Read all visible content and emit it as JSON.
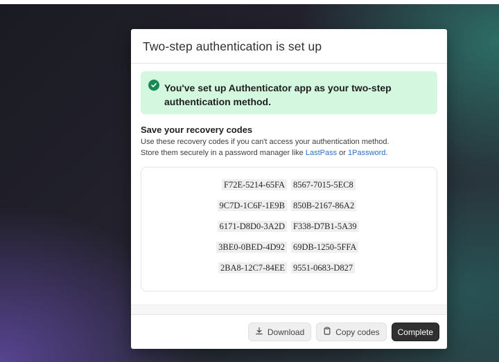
{
  "dialog": {
    "title": "Two-step authentication is set up",
    "banner": {
      "icon": "check-circle-icon",
      "text": "You've set up Authenticator app as your two-step authentication method."
    },
    "recovery": {
      "title": "Save your recovery codes",
      "desc_line1": "Use these recovery codes if you can't access your authentication method.",
      "desc_line2_prefix": "Store them securely in a password manager like ",
      "link1": "LastPass",
      "desc_or": " or ",
      "link2": "1Password",
      "desc_end": ".",
      "codes": [
        [
          "F72E-5214-65FA",
          "8567-7015-5EC8"
        ],
        [
          "9C7D-1C6F-1E9B",
          "850B-2167-86A2"
        ],
        [
          "6171-D8D0-3A2D",
          "F338-D7B1-5A39"
        ],
        [
          "3BE0-0BED-4D92",
          "69DB-1250-5FFA"
        ],
        [
          "2BA8-12C7-84EE",
          "9551-0683-D827"
        ]
      ]
    },
    "footer": {
      "download_label": "Download",
      "download_icon": "download-icon",
      "copy_label": "Copy codes",
      "copy_icon": "clipboard-icon",
      "complete_label": "Complete"
    }
  },
  "colors": {
    "banner_bg": "#d4f7df",
    "check_green": "#178a56",
    "link_blue": "#2c6ecb",
    "primary_button": "#303030"
  }
}
